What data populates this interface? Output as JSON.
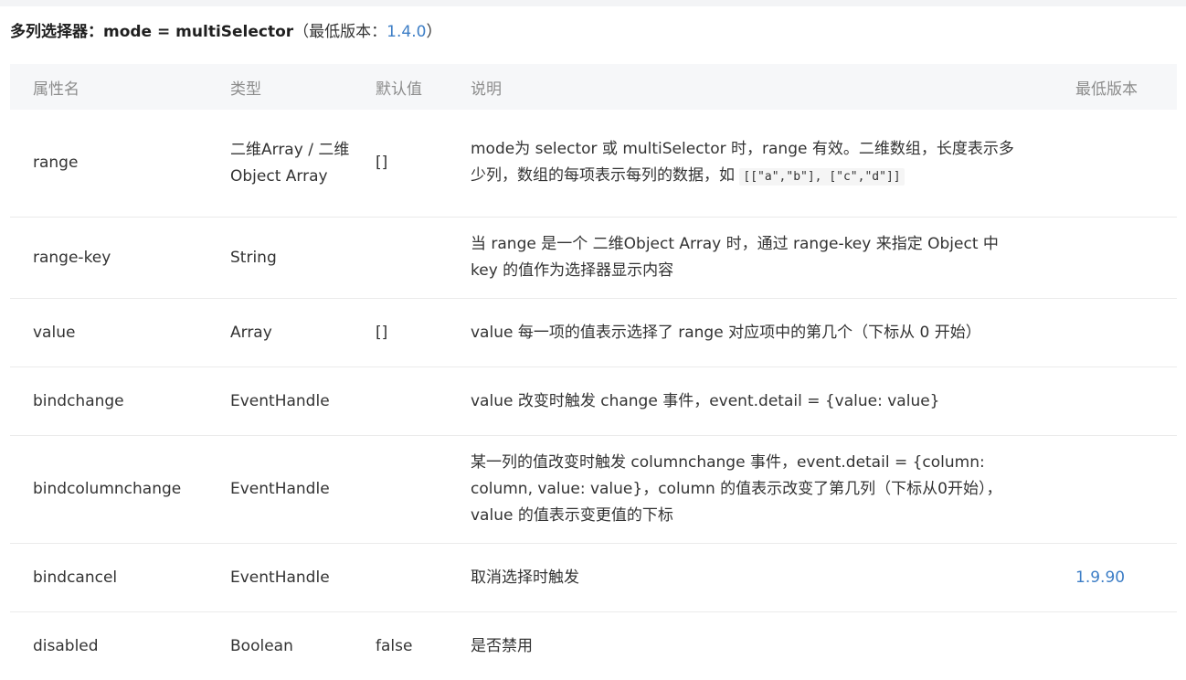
{
  "heading": {
    "prefix": "多列选择器：",
    "mode": "mode = multiSelector",
    "note_open": "（最低版本：",
    "version": "1.4.0",
    "note_close": "）"
  },
  "table": {
    "headers": [
      "属性名",
      "类型",
      "默认值",
      "说明",
      "最低版本"
    ],
    "rows": [
      {
        "name": "range",
        "type": "二维Array / 二维Object Array",
        "default": "[]",
        "desc": "mode为 selector 或 multiSelector 时，range 有效。二维数组，长度表示多少列，数组的每项表示每列的数据，如 ",
        "desc_code": "[[\"a\",\"b\"], [\"c\",\"d\"]]",
        "version": ""
      },
      {
        "name": "range-key",
        "type": "String",
        "default": "",
        "desc": "当 range 是一个 二维Object Array 时，通过 range-key 来指定 Object 中 key 的值作为选择器显示内容",
        "version": ""
      },
      {
        "name": "value",
        "type": "Array",
        "default": "[]",
        "desc": "value 每一项的值表示选择了 range 对应项中的第几个（下标从 0 开始）",
        "version": ""
      },
      {
        "name": "bindchange",
        "type": "EventHandle",
        "default": "",
        "desc": "value 改变时触发 change 事件，event.detail = {value: value}",
        "version": ""
      },
      {
        "name": "bindcolumnchange",
        "type": "EventHandle",
        "default": "",
        "desc": "某一列的值改变时触发 columnchange 事件，event.detail = {column: column, value: value}，column 的值表示改变了第几列（下标从0开始），value 的值表示变更值的下标",
        "version": ""
      },
      {
        "name": "bindcancel",
        "type": "EventHandle",
        "default": "",
        "desc": "取消选择时触发",
        "version": "1.9.90"
      },
      {
        "name": "disabled",
        "type": "Boolean",
        "default": "false",
        "desc": "是否禁用",
        "version": ""
      }
    ]
  },
  "colors": {
    "link": "#3d7ec6",
    "header_bg": "#f6f7f9",
    "header_text": "#8c8c8c",
    "row_border": "#ebebeb"
  }
}
